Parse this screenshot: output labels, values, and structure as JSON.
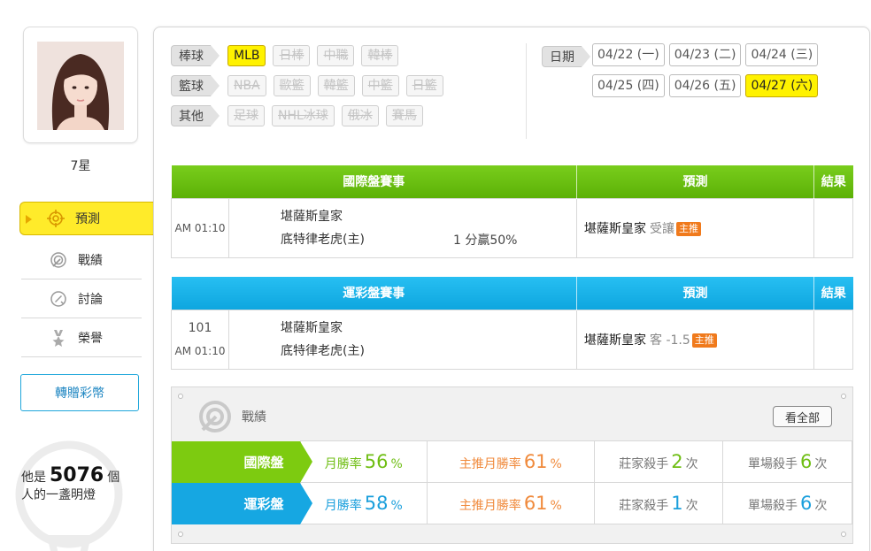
{
  "profile": {
    "rank_label": "7星"
  },
  "nav": {
    "items": [
      {
        "label": "預測",
        "icon": "target-icon",
        "active": true
      },
      {
        "label": "戰績",
        "icon": "record-icon",
        "active": false
      },
      {
        "label": "討論",
        "icon": "discussion-icon",
        "active": false
      },
      {
        "label": "榮譽",
        "icon": "medal-icon",
        "active": false
      }
    ]
  },
  "gift_button": "轉贈彩幣",
  "lamp": {
    "prefix": "他是",
    "count": "5076",
    "suffix": "個",
    "line2": "人的一盞明燈"
  },
  "filters": {
    "baseball": {
      "label": "棒球",
      "options": [
        "MLB",
        "日棒",
        "中職",
        "韓棒"
      ],
      "active": "MLB"
    },
    "basketball": {
      "label": "籃球",
      "options": [
        "NBA",
        "歐籃",
        "韓籃",
        "中籃",
        "日籃"
      ]
    },
    "other": {
      "label": "其他",
      "options": [
        "足球",
        "NHL冰球",
        "俄冰",
        "賽馬"
      ]
    }
  },
  "dates": {
    "label": "日期",
    "options": [
      "04/22 (一)",
      "04/23 (二)",
      "04/24 (三)",
      "04/25 (四)",
      "04/26 (五)",
      "04/27 (六)"
    ],
    "active": "04/27 (六)"
  },
  "international": {
    "headers": {
      "match": "國際盤賽事",
      "prediction": "預測",
      "result": "結果"
    },
    "row": {
      "time": "AM 01:10",
      "team1": "堪薩斯皇家",
      "team2": "底特律老虎(主)",
      "handicap": "1 分贏50%",
      "pick": "堪薩斯皇家",
      "pick_detail": "受讓",
      "badge": "主推"
    }
  },
  "lottery": {
    "headers": {
      "match": "運彩盤賽事",
      "prediction": "預測",
      "result": "結果"
    },
    "row": {
      "code": "101",
      "time": "AM 01:10",
      "team1": "堪薩斯皇家",
      "team2": "底特律老虎(主)",
      "pick": "堪薩斯皇家",
      "pick_detail": "客 -1.5",
      "badge": "主推"
    }
  },
  "record": {
    "title": "戰績",
    "see_all": "看全部",
    "rows": [
      {
        "label": "國際盤",
        "monthly_label": "月勝率",
        "monthly_value": "56",
        "monthly_unit": "%",
        "main_label": "主推月勝率",
        "main_value": "61",
        "main_unit": "%",
        "banker_label": "莊家殺手",
        "banker_value": "2",
        "banker_unit": "次",
        "single_label": "單場殺手",
        "single_value": "6",
        "single_unit": "次"
      },
      {
        "label": "運彩盤",
        "monthly_label": "月勝率",
        "monthly_value": "58",
        "monthly_unit": "%",
        "main_label": "主推月勝率",
        "main_value": "61",
        "main_unit": "%",
        "banker_label": "莊家殺手",
        "banker_value": "1",
        "banker_unit": "次",
        "single_label": "單場殺手",
        "single_value": "6",
        "single_unit": "次"
      }
    ]
  },
  "colors": {
    "green": "#7dcb10",
    "blue": "#16a7e2",
    "yellow": "#fff200",
    "orange": "#f08a3c"
  }
}
